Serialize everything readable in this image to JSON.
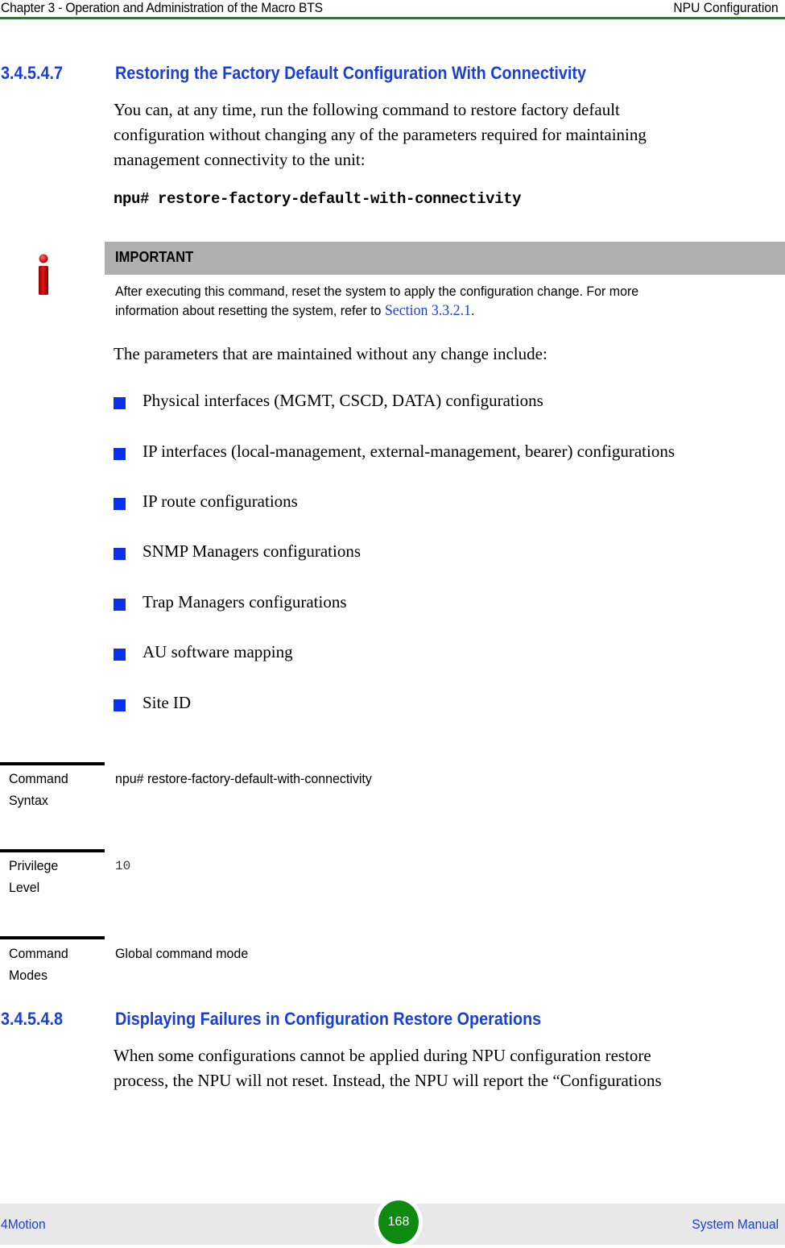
{
  "header": {
    "chapter": "Chapter 3 - Operation and Administration of the Macro BTS",
    "section": "NPU Configuration",
    "rule_color": "#138a12"
  },
  "section_1": {
    "number": "3.4.5.4.7",
    "title": "Restoring the Factory Default Configuration With Connectivity",
    "intro_lines": [
      "You can, at any time, run the following command to restore factory default",
      "configuration without changing any of the parameters required for maintaining",
      "management connectivity to the unit:"
    ],
    "command": "npu# restore-factory-default-with-connectivity"
  },
  "note": {
    "icon": "info-icon",
    "label": "IMPORTANT",
    "line1": "After executing this command, reset the system to apply the configuration change. For more",
    "line2_prefix": "information about resetting the system, refer to ",
    "link": "Section 3.3.2.1",
    "line2_suffix": "."
  },
  "params_intro": "The parameters that are maintained without any change include:",
  "bullets": [
    "Physical interfaces (MGMT, CSCD, DATA) configurations",
    "IP interfaces (local-management, external-management, bearer) configurations",
    "IP route configurations",
    "SNMP Managers configurations",
    "Trap Managers configurations",
    "AU software mapping",
    "Site ID"
  ],
  "command_table": [
    {
      "label_line1": "Command",
      "label_line2": "Syntax",
      "value": "npu# restore-factory-default-with-connectivity"
    },
    {
      "label_line1": "Privilege",
      "label_line2": "Level",
      "value": "10"
    },
    {
      "label_line1": "Command",
      "label_line2": "Modes",
      "value": "Global command mode"
    }
  ],
  "section_2": {
    "number": "3.4.5.4.8",
    "title": "Displaying Failures in Configuration Restore Operations",
    "lines": [
      "When some configurations cannot be applied during NPU configuration restore",
      "process, the NPU will not reset. Instead, the NPU will report the “Configurations"
    ]
  },
  "footer": {
    "product": "4Motion",
    "page": "168",
    "manual": "System Manual",
    "link_color": "#1a3fd6",
    "badge_color": "#0e8a10"
  }
}
